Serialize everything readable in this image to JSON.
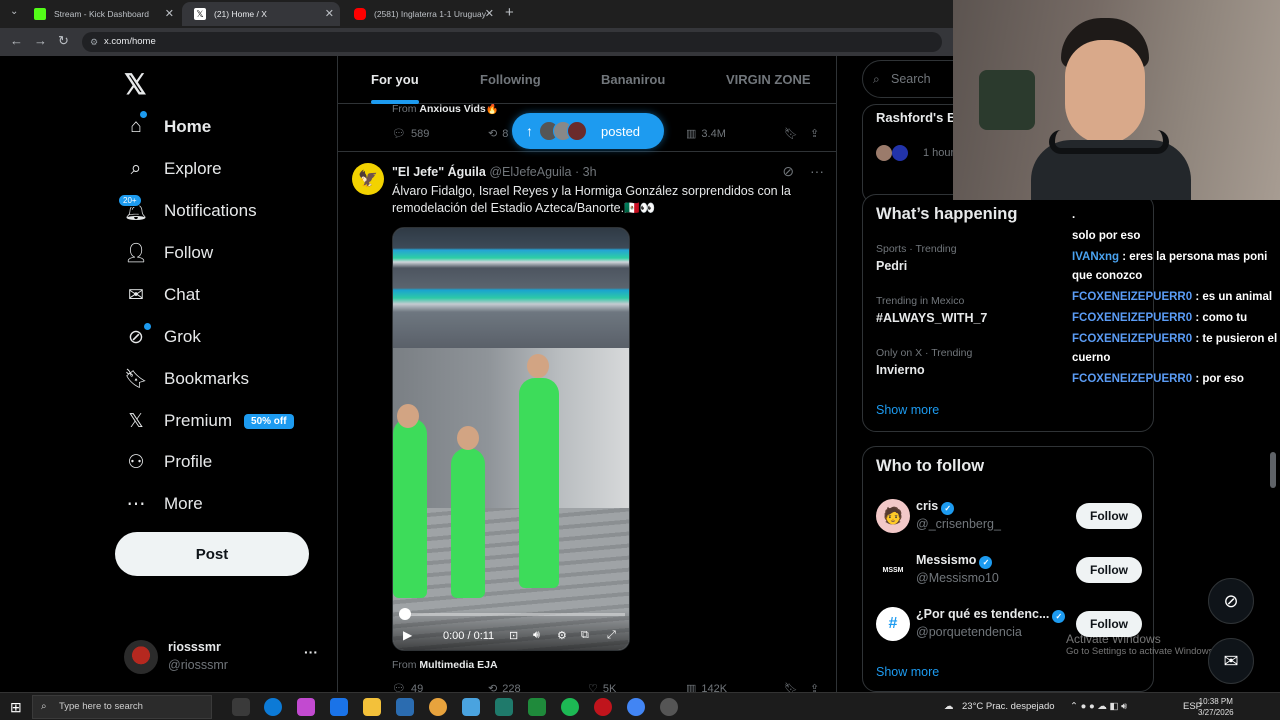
{
  "browser": {
    "tabs": [
      {
        "label": "Stream - Kick Dashboard",
        "favicon_color": "#53fc18"
      },
      {
        "label": "(21) Home / X",
        "favicon_color": "#ffffff"
      },
      {
        "label": "(2581) Inglaterra 1-1 Uruguay |",
        "favicon_color": "#ff0000"
      }
    ],
    "url": "x.com/home"
  },
  "nav": {
    "items": [
      {
        "label": "Home",
        "icon": "home-icon"
      },
      {
        "label": "Explore",
        "icon": "search-icon"
      },
      {
        "label": "Notifications",
        "icon": "bell-icon"
      },
      {
        "label": "Follow",
        "icon": "person-plus-icon"
      },
      {
        "label": "Chat",
        "icon": "mail-icon"
      },
      {
        "label": "Grok",
        "icon": "grok-icon"
      },
      {
        "label": "Bookmarks",
        "icon": "bookmark-icon"
      },
      {
        "label": "Premium",
        "icon": "x-icon"
      },
      {
        "label": "Profile",
        "icon": "person-icon"
      },
      {
        "label": "More",
        "icon": "more-circle-icon"
      }
    ],
    "notifications_badge": "20+",
    "premium_badge": "50% off",
    "post_button": "Post",
    "account": {
      "name": "riosssmr",
      "handle": "@riosssmr"
    }
  },
  "timeline": {
    "tabs": [
      "For you",
      "Following",
      "Bananirou",
      "VIRGIN ZONE"
    ],
    "active_tab": 0,
    "previous_post": {
      "from_label": "From",
      "from_name": "Anxious Vids🔥",
      "replies": "589",
      "reposts": "8",
      "views": "3.4M"
    },
    "posted_pill": "posted",
    "tweet": {
      "name": "\"El Jefe\" Águila",
      "handle": "@ElJefeAguila",
      "time": "· 3h",
      "text": "Álvaro Fidalgo, Israel Reyes y la Hormiga González sorprendidos con la remodelación del Estadio Azteca/Banorte.🇲🇽👀",
      "video_time": "0:00 / 0:11",
      "video_progress": 0.0,
      "from_label": "From",
      "from_name": "Multimedia EJA",
      "replies": "49",
      "reposts": "228",
      "likes": "5K",
      "views": "142K"
    }
  },
  "sidebar": {
    "search_placeholder": "Search",
    "news": {
      "headline": "Rashford's B... England Draw...",
      "meta": "1 hour"
    },
    "whats_happening": {
      "title": "What’s happening",
      "trends": [
        {
          "category": "Sports · Trending",
          "name": "Pedri"
        },
        {
          "category": "Trending in Mexico",
          "name": "#ALWAYS_WITH_7"
        },
        {
          "category": "Only on X · Trending",
          "name": "Invierno"
        }
      ],
      "show_more": "Show more"
    },
    "who_to_follow": {
      "title": "Who to follow",
      "accounts": [
        {
          "name": "cris",
          "handle": "@_crisenberg_",
          "button": "Follow"
        },
        {
          "name": "Messismo",
          "handle": "@Messismo10",
          "button": "Follow"
        },
        {
          "name": "¿Por qué es tendenc...",
          "handle": "@porquetendencia",
          "button": "Follow"
        }
      ],
      "show_more": "Show more"
    }
  },
  "stream_chat": [
    {
      "user": "",
      "text": "."
    },
    {
      "user": "",
      "text": "solo por eso"
    },
    {
      "user": "IVANxng",
      "text": ": eres la persona mas poni que conozco"
    },
    {
      "user": "FCOXENEIZEPUERR0",
      "text": ": es un animal"
    },
    {
      "user": "FCOXENEIZEPUERR0",
      "text": ": como tu"
    },
    {
      "user": "FCOXENEIZEPUERR0",
      "text": ": te pusieron el cuerno"
    },
    {
      "user": "FCOXENEIZEPUERR0",
      "text": ": por eso"
    }
  ],
  "windows_watermark": {
    "line1": "Activate Windows",
    "line2": "Go to Settings to activate Windows."
  },
  "taskbar": {
    "search_placeholder": "Type here to search",
    "weather": "23°C  Prac. despejado",
    "language": "ESP",
    "time": "10:38 PM",
    "date": "3/27/2026"
  }
}
